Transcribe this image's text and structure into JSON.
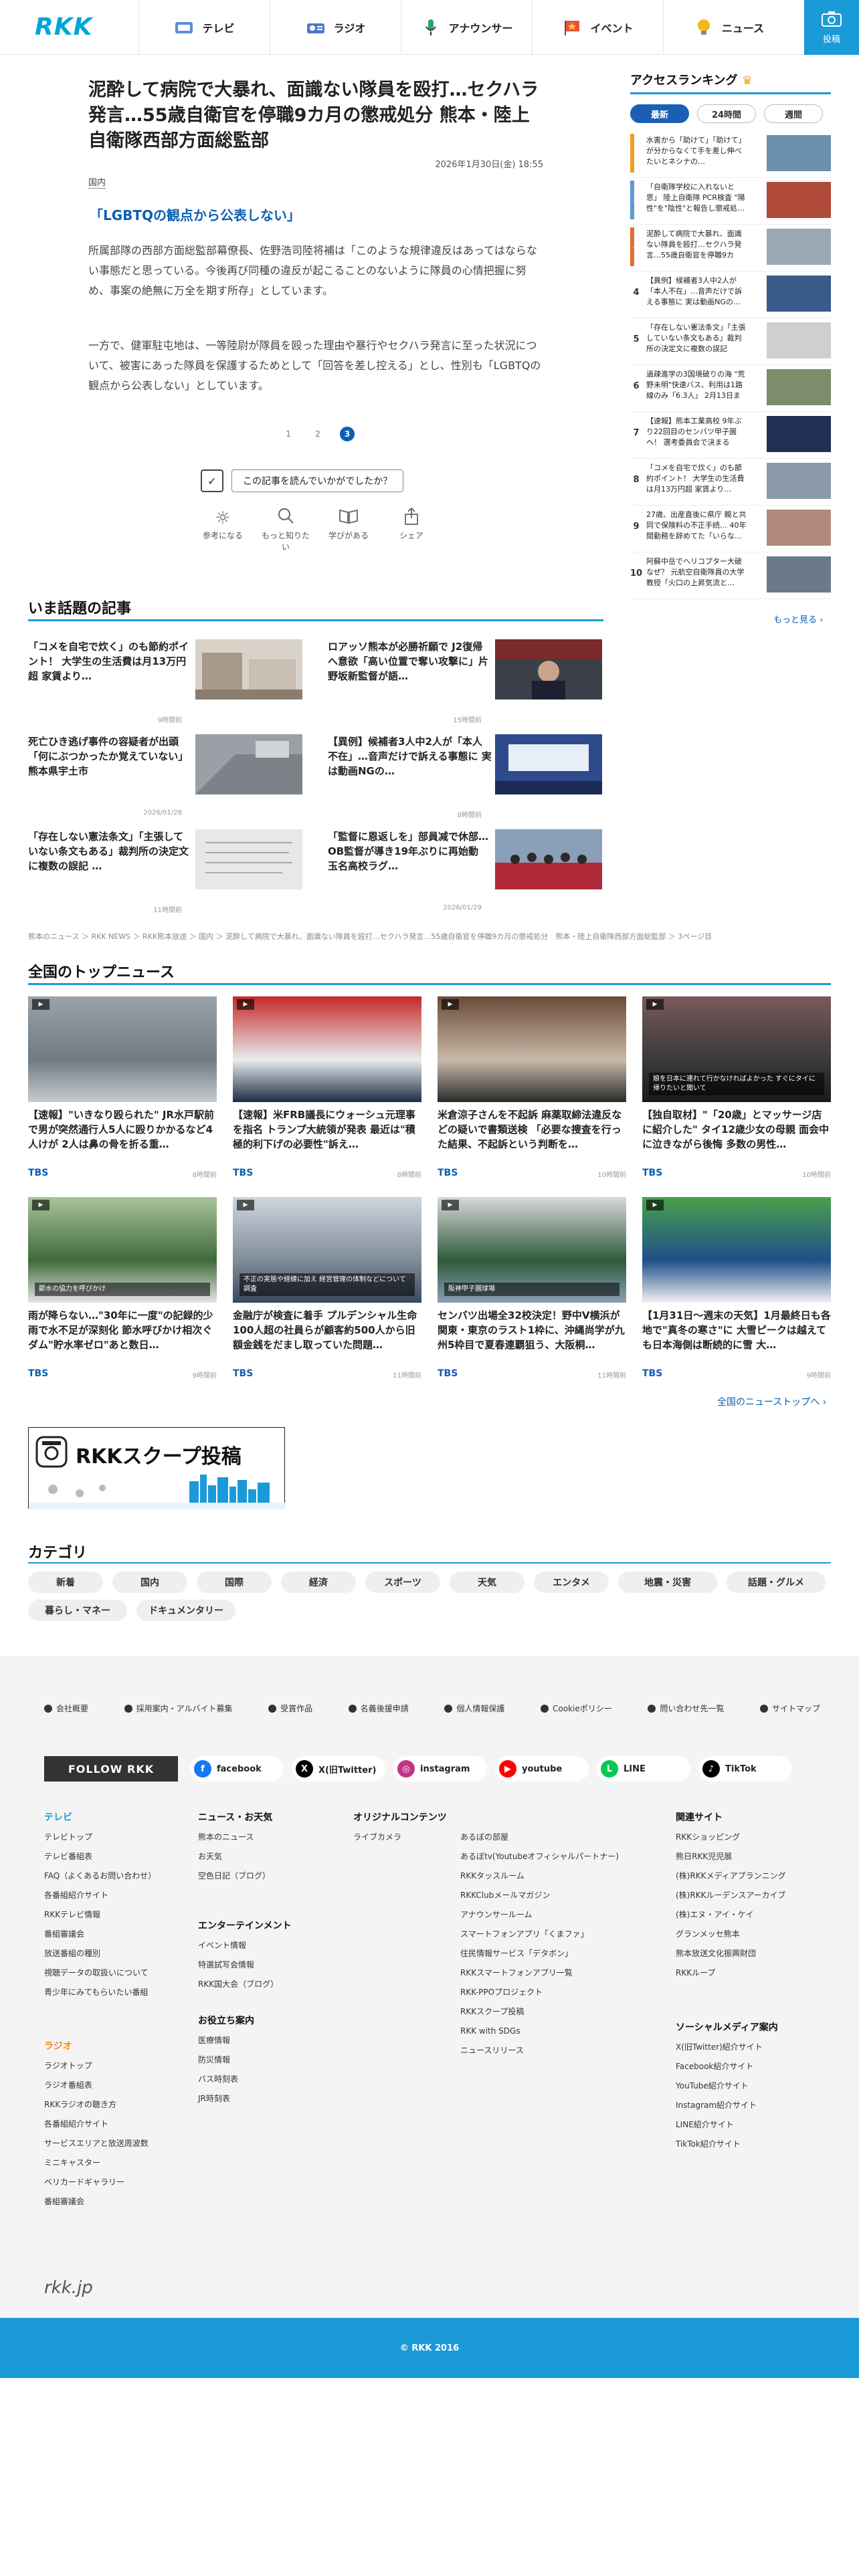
{
  "header": {
    "logo": "RKK",
    "nav": [
      {
        "label": "テレビ",
        "icon": "tv-icon"
      },
      {
        "label": "ラジオ",
        "icon": "radio-icon"
      },
      {
        "label": "アナウンサー",
        "icon": "microphone-icon"
      },
      {
        "label": "イベント",
        "icon": "flag-icon"
      },
      {
        "label": "ニュース",
        "icon": "lightbulb-icon"
      }
    ],
    "post_label": "投稿"
  },
  "article": {
    "title": "泥酔して病院で大暴れ、面識ない隊員を殴打…セクハラ発言…55歳自衛官を停職9カ月の懲戒処分 熊本・陸上自衛隊西部方面総監部",
    "date": "2026年1月30日(金) 18:55",
    "category": "国内",
    "subheading": "「LGBTQの観点から公表しない」",
    "p1": "所属部隊の西部方面総監部幕僚長、佐野浩司陸将補は「このような規律違反はあってはならない事態だと思っている。今後再び同種の違反が起こることのないように隊員の心情把握に努め、事案の絶無に万全を期す所存」としています。",
    "p2": "一方で、健軍駐屯地は、一等陸尉が隊員を殴った理由や暴行やセクハラ発言に至った状況について、被害にあった隊員を保護するためとして「回答を差し控える」とし、性別も「LGBTQの観点から公表しない」としています。",
    "pages": [
      "1",
      "2",
      "3"
    ],
    "current_page": "3",
    "question": "この記事を読んでいかがでしたか？",
    "reactions": [
      {
        "label": "参考になる",
        "icon": "lightbulb-icon"
      },
      {
        "label": "もっと知りたい",
        "icon": "magnifier-icon"
      },
      {
        "label": "学びがある",
        "icon": "book-icon"
      },
      {
        "label": "シェア",
        "icon": "share-icon"
      }
    ]
  },
  "ranking": {
    "title": "アクセスランキング",
    "tabs": [
      "最新",
      "24時間",
      "週間"
    ],
    "active_tab": "最新",
    "items": [
      {
        "rank": "1",
        "title": "水害から「助けて」「助けて」が分からなくて手を差し伸べたいとネシナの…",
        "color": "#f0a020"
      },
      {
        "rank": "2",
        "title": "「自衛隊学校に入れないと思」 陸上自衛隊 PCR検査 \"陽性\"を\"陰性\"と報告し懲戒処…",
        "color": "#5b9bd5"
      },
      {
        "rank": "3",
        "title": "泥酔して病院で大暴れ、面識ない隊員を殴打…セクハラ発言…55歳自衛官を停職9カ月…",
        "color": "#e07030"
      },
      {
        "rank": "4",
        "title": "【異例】候補者3人中2人が「本人不在」…音声だけで訴える事態に 実は動画NGの…",
        "color": "#ffffff"
      },
      {
        "rank": "5",
        "title": "「存在しない憲法条文」「主張していない条文もある」裁判所の決定文に複数の誤記",
        "color": "#ffffff"
      },
      {
        "rank": "6",
        "title": "過疎進学の3国境破りの海 \"荒野未明\"快速バス、利用は1路線のみ「6.3人」 2月13日まで",
        "color": "#ffffff"
      },
      {
        "rank": "7",
        "title": "【速報】熊本工業高校 9年ぶり22回目のセンバツ甲子園へ！ 選考委員会で決まる",
        "color": "#ffffff"
      },
      {
        "rank": "8",
        "title": "「コメを自宅で炊く」のも節約ポイント！ 大学生の生活費は月13万円超 家賃より…",
        "color": "#ffffff"
      },
      {
        "rank": "9",
        "title": "27歳、出産直後に県庁 親と共同で保険料の不正手続… 40年間勤務を辞めてた「いらな…",
        "color": "#ffffff"
      },
      {
        "rank": "10",
        "title": "阿蘇中岳でヘリコプター大破 なぜ？ 元航空自衛隊員の大学教授「火口の上昇気流と…",
        "color": "#ffffff"
      }
    ],
    "more": "もっと見る ›"
  },
  "trending": {
    "title": "いま話題の記事",
    "items": [
      {
        "title": "「コメを自宅で炊く」のも節約ポイント！ 大学生の生活費は月13万円超 家賃より…",
        "time": "9時間前"
      },
      {
        "title": "ロアッソ熊本が必勝祈願で J2復帰へ意欲「高い位置で奪い攻撃に」片野坂新監督が語…",
        "time": "15時間前"
      },
      {
        "title": "死亡ひき逃げ事件の容疑者が出頭「何にぶつかったか覚えていない」熊本県宇土市",
        "time": "2026/01/28"
      },
      {
        "title": "【異例】候補者3人中2人が「本人不在」…音声だけで訴える事態に 実は動画NGの…",
        "time": "8時間前"
      },
      {
        "title": "「存在しない憲法条文」「主張していない条文もある」裁判所の決定文に複数の誤記 …",
        "time": "11時間前"
      },
      {
        "title": "「監督に恩返しを」部員减で休部…OB監督が導き19年ぶりに再始動 玉名高校ラグ…",
        "time": "2026/01/29"
      }
    ]
  },
  "breadcrumb": "熊本のニュース ＞ RKK NEWS ＞ RKK熊本放送 ＞ 国内 ＞ 泥酔して病院で大暴れ、面識ない隊員を殴打…セクハラ発言…55歳自衛官を停職9カ月の懲戒処分　熊本・陸上自衛隊西部方面総監部 ＞ 3ページ目",
  "top_news": {
    "title": "全国のトップニュース",
    "items": [
      {
        "title": "【速報】\"いきなり殴られた\" JR水戸駅前で男が突然通行人5人に殴りかかるなど4人けが 2人は鼻の骨を折る重…",
        "source": "TBS",
        "time": "8時間前",
        "caption": ""
      },
      {
        "title": "【速報】米FRB議長にウォーシュ元理事を指名 トランプ大統領が発表 最近は\"積極的利下げの必要性\"訴え…",
        "source": "TBS",
        "time": "8時間前",
        "caption": ""
      },
      {
        "title": "米倉涼子さんを不起訴 麻薬取締法違反などの疑いで書類送検 「必要な捜査を行った結果、不起訴という判断を…",
        "source": "TBS",
        "time": "10時間前",
        "caption": ""
      },
      {
        "title": "【独自取材】\"「20歳」とマッサージ店に紹介した\" タイ12歳少女の母親 面会中に泣きながら後悔 多数の男性…",
        "source": "TBS",
        "time": "10時間前",
        "caption": "娘を日本に連れて行かなければよかった すぐにタイに帰りたいと聞いて"
      },
      {
        "title": "雨が降らない…\"30年に一度\"の記録的少雨で水不足が深刻化 節水呼びかけ相次ぐ ダム\"貯水率ゼロ\"あと数日…",
        "source": "TBS",
        "time": "9時間前",
        "caption": "節水の協力を呼びかけ"
      },
      {
        "title": "金融庁が検査に着手 プルデンシャル生命100人超の社員らが顧客約500人から旧額金銭をだまし取っていた問題…",
        "source": "TBS",
        "time": "11時間前",
        "caption": "不正の実態や経緯に加え 経営管理の体制などについて調査"
      },
      {
        "title": "センバツ出場全32校決定！野中V横浜が関東・東京のラスト1枠に、沖縄尚学が九州5枠目で夏春連覇狙う、大阪桐…",
        "source": "TBS",
        "time": "11時間前",
        "caption": "阪神甲子園球場"
      },
      {
        "title": "【1月31日～週末の天気】1月最終日も各地で\"真冬の寒さ\"に 大雪ピークは越えても日本海側は断続的に雪 大…",
        "source": "TBS",
        "time": "9時間前",
        "caption": ""
      }
    ],
    "more": "全国のニューストップへ ›"
  },
  "scoop": {
    "label": "RKKスクープ投稿"
  },
  "categories": {
    "title": "カテゴリ",
    "items": [
      "新着",
      "国内",
      "国際",
      "経済",
      "スポーツ",
      "天気",
      "エンタメ",
      "地震・災害",
      "話題・グルメ",
      "暮らし・マネー",
      "ドキュメンタリー"
    ]
  },
  "footer": {
    "top_links": [
      "会社概要",
      "採用案内・アルバイト募集",
      "受賞作品",
      "名義後援申請",
      "個人情報保護",
      "Cookieポリシー",
      "問い合わせ先一覧",
      "サイトマップ"
    ],
    "follow": "FOLLOW RKK",
    "social": [
      {
        "label": "facebook",
        "color": "#1877f2",
        "glyph": "f"
      },
      {
        "label": "X(旧Twitter)",
        "color": "#000000",
        "glyph": "X"
      },
      {
        "label": "instagram",
        "color": "#c13584",
        "glyph": "◎"
      },
      {
        "label": "youtube",
        "color": "#ff0000",
        "glyph": "▶"
      },
      {
        "label": "LINE",
        "color": "#06c755",
        "glyph": "L"
      },
      {
        "label": "TikTok",
        "color": "#000000",
        "glyph": "♪"
      }
    ],
    "tv": {
      "title": "テレビ",
      "items": [
        "テレビトップ",
        "テレビ番組表",
        "FAQ（よくあるお問い合わせ）",
        "各番組紹介サイト",
        "RKKテレビ情報",
        "番組審議会",
        "放送番組の種別",
        "視聴データの取扱いについて",
        "青少年にみてもらいたい番組"
      ]
    },
    "radio": {
      "title": "ラジオ",
      "items": [
        "ラジオトップ",
        "ラジオ番組表",
        "RKKラジオの聴き方",
        "各番組紹介サイト",
        "サービスエリアと放送周波数",
        "ミニキャスター",
        "ベリカードギャラリー",
        "番組審議会"
      ]
    },
    "news": {
      "title": "ニュース・お天気",
      "items": [
        "熊本のニュース",
        "お天気",
        "空色日記（ブログ）"
      ]
    },
    "ent": {
      "title": "エンターテインメント",
      "items": [
        "イベント情報",
        "特選試写会情報",
        "RKK国大会（ブログ）"
      ]
    },
    "useful": {
      "title": "お役立ち案内",
      "items": [
        "医療情報",
        "防災情報",
        "バス時刻表",
        "JR時刻表"
      ]
    },
    "original": {
      "title": "オリジナルコンテンツ",
      "left": [
        "ライブカメラ"
      ],
      "right": [
        "あるぼの部屋",
        "あるぼtv(Youtubeオフィシャルパートナー)",
        "RKKタッスルーム",
        "RKKClubメールマガジン",
        "アナウンサールーム",
        "スマートフォンアプリ「くまファ」",
        "住民情報サービス「デタボン」",
        "RKKスマートフォンアプリ一覧",
        "RKK-PPOプロジェクト",
        "RKKスクープ投稿",
        "RKK with SDGs",
        "ニュースリリース"
      ]
    },
    "related": {
      "title": "関連サイト",
      "items": [
        "RKKショッピング",
        "熊日RKK児児展",
        "(株)RKKメディアプランニング",
        "(株)RKKルーデンスアーカイブ",
        "(株)エヌ・アイ・ケイ",
        "グランメッセ熊本",
        "熊本放送文化振興財団",
        "RKKループ"
      ]
    },
    "sns": {
      "title": "ソーシャルメディア案内",
      "items": [
        "X(旧Twitter)紹介サイト",
        "Facebook紹介サイト",
        "YouTube紹介サイト",
        "Instagram紹介サイト",
        "LINE紹介サイト",
        "TikTok紹介サイト"
      ]
    },
    "domain": "rkk.jp",
    "copyright": "© RKK 2016"
  },
  "colors": {
    "accent": "#1b9ad8",
    "link": "#0a5fb4",
    "footer_bg": "#f4f4f4"
  }
}
